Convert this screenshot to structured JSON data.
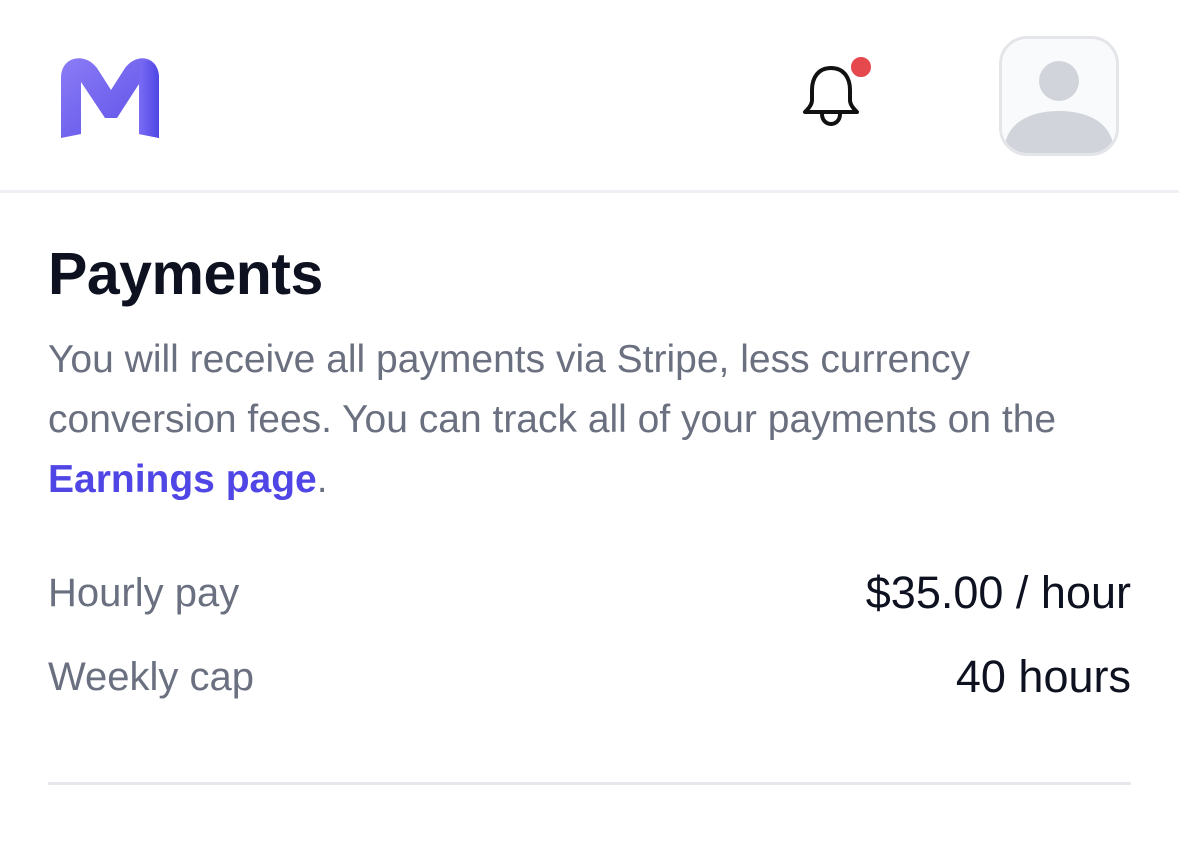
{
  "header": {
    "logo_icon": "m-logo-icon",
    "notification_icon": "bell-icon",
    "notification_badge_color": "#e5484d",
    "avatar_icon": "user-avatar-icon"
  },
  "payments": {
    "title": "Payments",
    "description_before_link": "You will receive all payments via Stripe, less currency conversion fees. You can track all of your payments on the ",
    "link_text": "Earnings page",
    "description_after_link": ".",
    "rows": [
      {
        "label": "Hourly pay",
        "value": "$35.00 / hour"
      },
      {
        "label": "Weekly cap",
        "value": "40 hours"
      }
    ]
  },
  "colors": {
    "brand": "#4f46e5",
    "text_primary": "#0d1120",
    "text_secondary": "#6b7080"
  }
}
